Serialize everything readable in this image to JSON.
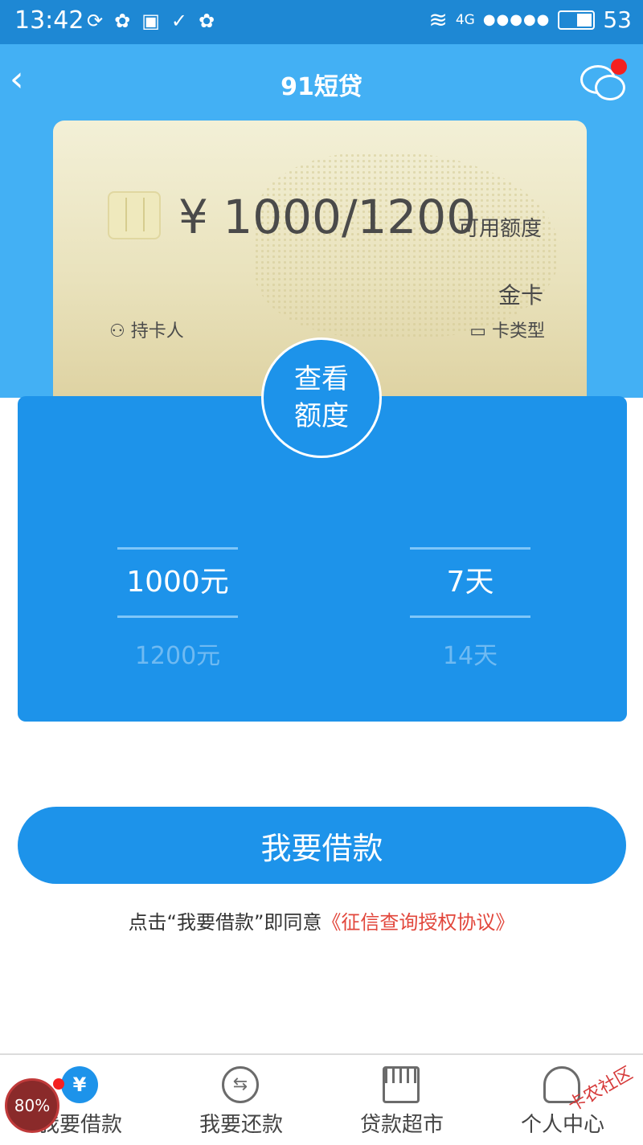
{
  "statusbar": {
    "time": "13:42",
    "network": "4G",
    "signal": "●●●●●",
    "battery": "53",
    "notification_icons": [
      "sync-icon",
      "baidu-icon",
      "image-icon",
      "check-icon",
      "baidu-icon"
    ]
  },
  "nav": {
    "title": "91短贷",
    "back_icon": "chevron-left-icon",
    "message_icon": "chat-icon"
  },
  "card": {
    "amount": "¥ 1000/1200",
    "amount_label": "可用额度",
    "card_type": "金卡",
    "holder_label": "持卡人",
    "type_label": "卡类型"
  },
  "view_button": {
    "line1": "查看",
    "line2": "额度"
  },
  "pickers": {
    "amount": {
      "selected": "1000元",
      "next": "1200元"
    },
    "days": {
      "selected": "7天",
      "next": "14天"
    }
  },
  "borrow_button": "我要借款",
  "agreement": {
    "prefix": "点击“我要借款”即同意",
    "link": "《征信查询授权协议》"
  },
  "tabs": [
    {
      "label": "我要借款",
      "icon": "yen-icon"
    },
    {
      "label": "我要还款",
      "icon": "swap-icon"
    },
    {
      "label": "贷款超市",
      "icon": "store-icon"
    },
    {
      "label": "个人中心",
      "icon": "user-icon"
    }
  ],
  "overlay": {
    "badge": "80%",
    "watermark": "卡农社区"
  },
  "colors": {
    "primary": "#1d93ea",
    "header": "#43b0f4",
    "link": "#e2473c"
  }
}
